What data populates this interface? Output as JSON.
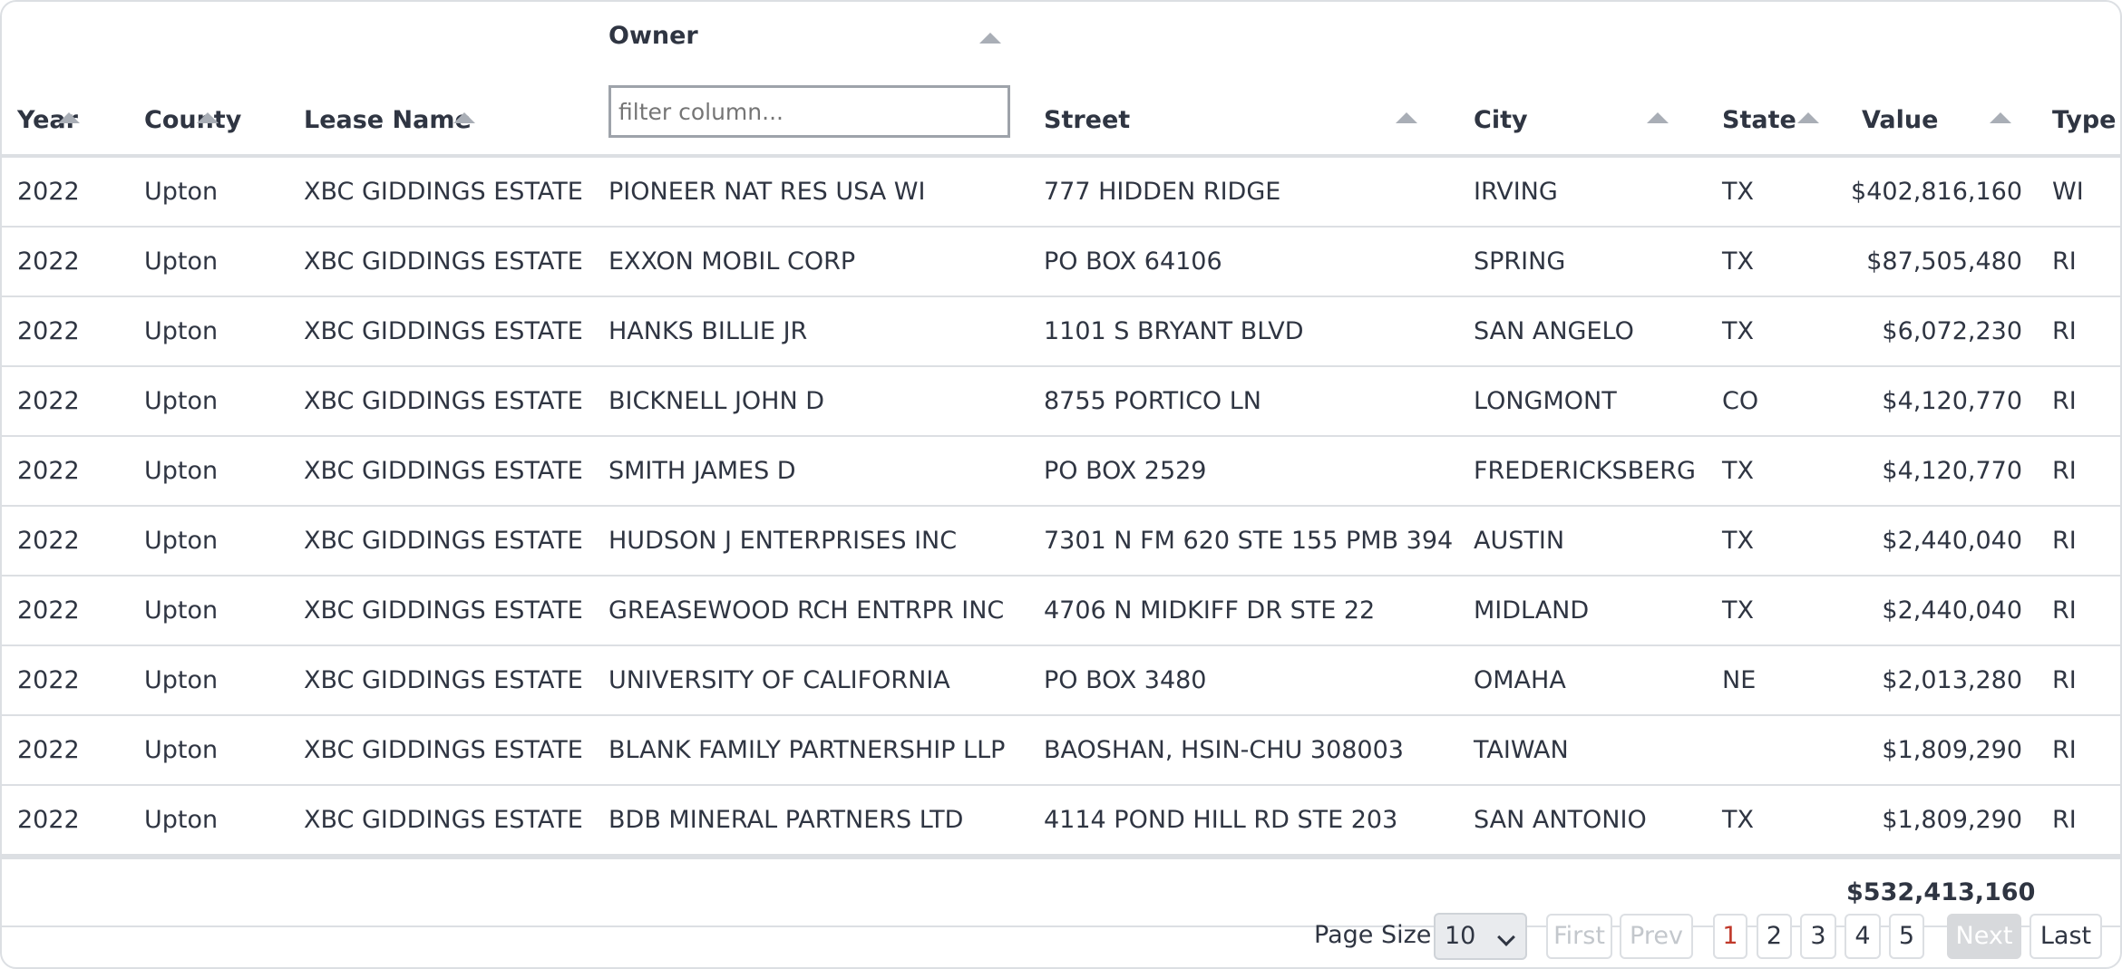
{
  "table": {
    "headers": {
      "year": "Year",
      "county": "County",
      "lease": "Lease Name",
      "owner": "Owner",
      "street": "Street",
      "city": "City",
      "state": "State",
      "value": "Value",
      "type": "Type"
    },
    "owner_filter_placeholder": "filter column...",
    "rows": [
      {
        "year": "2022",
        "county": "Upton",
        "lease": "XBC GIDDINGS ESTATE",
        "owner": "PIONEER NAT RES USA WI",
        "street": "777 HIDDEN RIDGE",
        "city": "IRVING",
        "state": "TX",
        "value": "$402,816,160",
        "type": "WI"
      },
      {
        "year": "2022",
        "county": "Upton",
        "lease": "XBC GIDDINGS ESTATE",
        "owner": "EXXON MOBIL CORP",
        "street": "PO BOX 64106",
        "city": "SPRING",
        "state": "TX",
        "value": "$87,505,480",
        "type": "RI"
      },
      {
        "year": "2022",
        "county": "Upton",
        "lease": "XBC GIDDINGS ESTATE",
        "owner": "HANKS BILLIE JR",
        "street": "1101 S BRYANT BLVD",
        "city": "SAN ANGELO",
        "state": "TX",
        "value": "$6,072,230",
        "type": "RI"
      },
      {
        "year": "2022",
        "county": "Upton",
        "lease": "XBC GIDDINGS ESTATE",
        "owner": "BICKNELL JOHN D",
        "street": "8755 PORTICO LN",
        "city": "LONGMONT",
        "state": "CO",
        "value": "$4,120,770",
        "type": "RI"
      },
      {
        "year": "2022",
        "county": "Upton",
        "lease": "XBC GIDDINGS ESTATE",
        "owner": "SMITH JAMES D",
        "street": "PO BOX 2529",
        "city": "FREDERICKSBERG",
        "state": "TX",
        "value": "$4,120,770",
        "type": "RI"
      },
      {
        "year": "2022",
        "county": "Upton",
        "lease": "XBC GIDDINGS ESTATE",
        "owner": "HUDSON J ENTERPRISES INC",
        "street": "7301 N FM 620 STE 155 PMB 394",
        "city": "AUSTIN",
        "state": "TX",
        "value": "$2,440,040",
        "type": "RI"
      },
      {
        "year": "2022",
        "county": "Upton",
        "lease": "XBC GIDDINGS ESTATE",
        "owner": "GREASEWOOD RCH ENTRPR INC",
        "street": "4706 N MIDKIFF DR STE 22",
        "city": "MIDLAND",
        "state": "TX",
        "value": "$2,440,040",
        "type": "RI"
      },
      {
        "year": "2022",
        "county": "Upton",
        "lease": "XBC GIDDINGS ESTATE",
        "owner": "UNIVERSITY OF CALIFORNIA",
        "street": "PO BOX 3480",
        "city": "OMAHA",
        "state": "NE",
        "value": "$2,013,280",
        "type": "RI"
      },
      {
        "year": "2022",
        "county": "Upton",
        "lease": "XBC GIDDINGS ESTATE",
        "owner": "BLANK FAMILY PARTNERSHIP LLP",
        "street": "BAOSHAN, HSIN-CHU 308003",
        "city": "TAIWAN",
        "state": "",
        "value": "$1,809,290",
        "type": "RI"
      },
      {
        "year": "2022",
        "county": "Upton",
        "lease": "XBC GIDDINGS ESTATE",
        "owner": "BDB MINERAL PARTNERS LTD",
        "street": "4114 POND HILL RD STE 203",
        "city": "SAN ANTONIO",
        "state": "TX",
        "value": "$1,809,290",
        "type": "RI"
      }
    ],
    "total_value": "$532,413,160"
  },
  "pagination": {
    "page_size_label": "Page Size",
    "page_size": "10",
    "first": "First",
    "prev": "Prev",
    "pages": [
      "1",
      "2",
      "3",
      "4",
      "5"
    ],
    "current_page": "1",
    "next": "Next",
    "last": "Last"
  },
  "colors": {
    "text": "#2f3542",
    "border": "#dcdfe3",
    "active_page": "#c0392b",
    "sort_arrow": "#a9aeb6"
  },
  "icons": {
    "sort": "sort-ascending-icon",
    "select": "chevron-down-icon"
  }
}
